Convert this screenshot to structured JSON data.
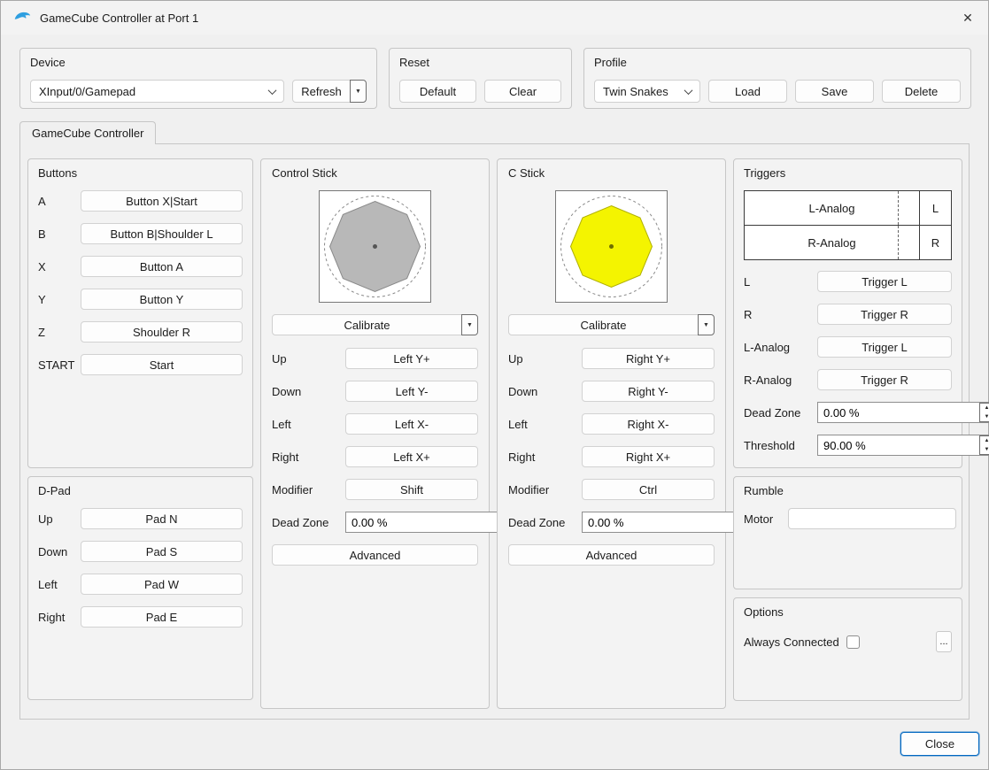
{
  "window": {
    "title": "GameCube Controller at Port 1"
  },
  "icons": {
    "close": "✕",
    "dropdown_arrow": "▼",
    "spin_up": "▲",
    "spin_down": "▼",
    "ellipsis": "..."
  },
  "device": {
    "label": "Device",
    "value": "XInput/0/Gamepad",
    "refresh_label": "Refresh"
  },
  "reset": {
    "label": "Reset",
    "default_label": "Default",
    "clear_label": "Clear"
  },
  "profile": {
    "label": "Profile",
    "value": "Twin Snakes",
    "load_label": "Load",
    "save_label": "Save",
    "delete_label": "Delete"
  },
  "tabs": {
    "gamecube": "GameCube Controller"
  },
  "buttons_group": {
    "title": "Buttons",
    "rows": [
      {
        "label": "A",
        "value": "Button X|Start"
      },
      {
        "label": "B",
        "value": "Button B|Shoulder L"
      },
      {
        "label": "X",
        "value": "Button A"
      },
      {
        "label": "Y",
        "value": "Button Y"
      },
      {
        "label": "Z",
        "value": "Shoulder R"
      },
      {
        "label": "START",
        "value": "Start"
      }
    ]
  },
  "dpad_group": {
    "title": "D-Pad",
    "rows": [
      {
        "label": "Up",
        "value": "Pad N"
      },
      {
        "label": "Down",
        "value": "Pad S"
      },
      {
        "label": "Left",
        "value": "Pad W"
      },
      {
        "label": "Right",
        "value": "Pad E"
      }
    ]
  },
  "control_stick": {
    "title": "Control Stick",
    "calibrate_label": "Calibrate",
    "rows": [
      {
        "label": "Up",
        "value": "Left Y+"
      },
      {
        "label": "Down",
        "value": "Left Y-"
      },
      {
        "label": "Left",
        "value": "Left X-"
      },
      {
        "label": "Right",
        "value": "Left X+"
      },
      {
        "label": "Modifier",
        "value": "Shift"
      }
    ],
    "dead_zone_label": "Dead Zone",
    "dead_zone_value": "0.00 %",
    "advanced_label": "Advanced",
    "gate_color": "#b8b8b8",
    "gate_stroke": "#8a8a8a"
  },
  "c_stick": {
    "title": "C Stick",
    "calibrate_label": "Calibrate",
    "rows": [
      {
        "label": "Up",
        "value": "Right Y+"
      },
      {
        "label": "Down",
        "value": "Right Y-"
      },
      {
        "label": "Left",
        "value": "Right X-"
      },
      {
        "label": "Right",
        "value": "Right X+"
      },
      {
        "label": "Modifier",
        "value": "Ctrl"
      }
    ],
    "dead_zone_label": "Dead Zone",
    "dead_zone_value": "0.00 %",
    "advanced_label": "Advanced",
    "gate_color": "#f4f400",
    "gate_stroke": "#b0b000"
  },
  "triggers": {
    "title": "Triggers",
    "bars": [
      {
        "analog_label": "L-Analog",
        "digital_label": "L"
      },
      {
        "analog_label": "R-Analog",
        "digital_label": "R"
      }
    ],
    "rows": [
      {
        "label": "L",
        "value": "Trigger L"
      },
      {
        "label": "R",
        "value": "Trigger R"
      },
      {
        "label": "L-Analog",
        "value": "Trigger L"
      },
      {
        "label": "R-Analog",
        "value": "Trigger R"
      }
    ],
    "dead_zone_label": "Dead Zone",
    "dead_zone_value": "0.00 %",
    "threshold_label": "Threshold",
    "threshold_value": "90.00 %",
    "threshold_percent": 90
  },
  "rumble": {
    "title": "Rumble",
    "motor_label": "Motor",
    "motor_value": ""
  },
  "options": {
    "title": "Options",
    "always_connected_label": "Always Connected",
    "always_connected_checked": false
  },
  "footer": {
    "close_label": "Close"
  }
}
